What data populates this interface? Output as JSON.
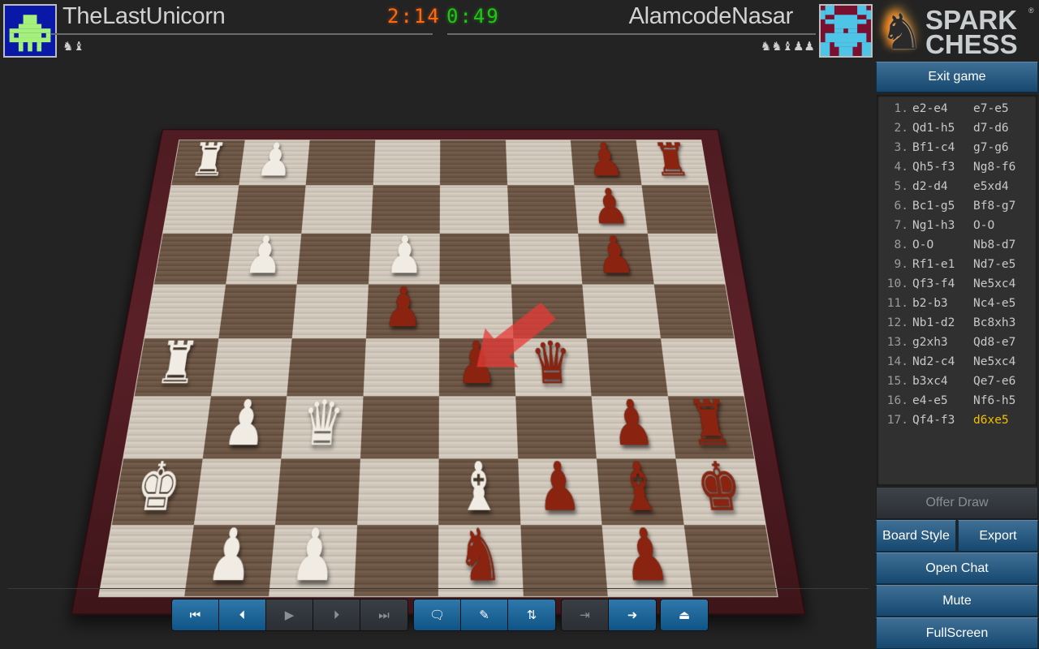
{
  "players": {
    "white": {
      "name": "TheLastUnicorn",
      "captured": "♞♝",
      "clock": "2:14",
      "clock_color": "#ff6a10",
      "avatar_colors": {
        "bg": "#0a18a8",
        "fg": "#a4f07a"
      }
    },
    "black": {
      "name": "AlamcodeNasar",
      "captured": "♞♞♝♟♟",
      "clock": "0:49",
      "clock_color": "#22c416",
      "avatar_colors": {
        "bg": "#7a1030",
        "fg": "#4ec4e6"
      }
    }
  },
  "logo": {
    "line1": "SPARK",
    "line2": "CHESS",
    "registered": "®"
  },
  "buttons": {
    "exit": "Exit game",
    "offer_draw": "Offer Draw",
    "board_style": "Board Style",
    "export": "Export",
    "open_chat": "Open Chat",
    "mute": "Mute",
    "fullscreen": "FullScreen"
  },
  "moves": [
    {
      "n": "1.",
      "w": "e2-e4",
      "b": "e7-e5"
    },
    {
      "n": "2.",
      "w": "Qd1-h5",
      "b": "d7-d6"
    },
    {
      "n": "3.",
      "w": "Bf1-c4",
      "b": "g7-g6"
    },
    {
      "n": "4.",
      "w": "Qh5-f3",
      "b": "Ng8-f6"
    },
    {
      "n": "5.",
      "w": "d2-d4",
      "b": "e5xd4"
    },
    {
      "n": "6.",
      "w": "Bc1-g5",
      "b": "Bf8-g7"
    },
    {
      "n": "7.",
      "w": "Ng1-h3",
      "b": "O-O"
    },
    {
      "n": "8.",
      "w": "O-O",
      "b": "Nb8-d7"
    },
    {
      "n": "9.",
      "w": "Rf1-e1",
      "b": "Nd7-e5"
    },
    {
      "n": "10.",
      "w": "Qf3-f4",
      "b": "Ne5xc4"
    },
    {
      "n": "11.",
      "w": "b2-b3",
      "b": "Nc4-e5"
    },
    {
      "n": "12.",
      "w": "Nb1-d2",
      "b": "Bc8xh3"
    },
    {
      "n": "13.",
      "w": "g2xh3",
      "b": "Qd8-e7"
    },
    {
      "n": "14.",
      "w": "Nd2-c4",
      "b": "Ne5xc4"
    },
    {
      "n": "15.",
      "w": "b3xc4",
      "b": "Qe7-e6"
    },
    {
      "n": "16.",
      "w": "e4-e5",
      "b": "Nf6-h5"
    },
    {
      "n": "17.",
      "w": "Qf4-f3",
      "b": "d6xe5"
    }
  ],
  "last_move_color": "#f0c000",
  "board": {
    "orientation": "black-at-bottom",
    "rows": [
      [
        "wR",
        "wP",
        "",
        "",
        "",
        "",
        "bP",
        "bR"
      ],
      [
        "",
        "",
        "",
        "",
        "",
        "",
        "bP",
        ""
      ],
      [
        "",
        "wP",
        "",
        "wP",
        "",
        "",
        "bP",
        ""
      ],
      [
        "",
        "",
        "",
        "bP",
        "",
        "",
        "",
        ""
      ],
      [
        "wR",
        "",
        "",
        "",
        "bP",
        "bQ",
        "",
        ""
      ],
      [
        "",
        "wP",
        "wQ",
        "",
        "",
        "",
        "bP",
        "bR"
      ],
      [
        "wK",
        "",
        "",
        "",
        "wB",
        "bP",
        "bB",
        "bK"
      ],
      [
        "",
        "wP",
        "wP",
        "",
        "bN",
        "",
        "bP",
        ""
      ]
    ],
    "last_move_arrow": {
      "from": [
        3,
        5
      ],
      "to": [
        4,
        4
      ],
      "color": "#e53935"
    }
  },
  "toolbar": {
    "nav": [
      {
        "name": "first-move",
        "icon": "⏮",
        "enabled": true
      },
      {
        "name": "previous-move",
        "icon": "⏴",
        "enabled": true
      },
      {
        "name": "play",
        "icon": "▶",
        "enabled": false
      },
      {
        "name": "next-move",
        "icon": "⏵",
        "enabled": false
      },
      {
        "name": "last-move",
        "icon": "⏭",
        "enabled": false
      }
    ],
    "tools": [
      {
        "name": "comment",
        "icon": "🗨",
        "enabled": true
      },
      {
        "name": "edit",
        "icon": "✎",
        "enabled": true
      },
      {
        "name": "flip-board",
        "icon": "⇅",
        "enabled": true
      }
    ],
    "io": [
      {
        "name": "import",
        "icon": "⇥",
        "enabled": false
      },
      {
        "name": "leave",
        "icon": "➜",
        "enabled": true
      }
    ],
    "eject": [
      {
        "name": "eject",
        "icon": "⏏",
        "enabled": true
      }
    ]
  }
}
